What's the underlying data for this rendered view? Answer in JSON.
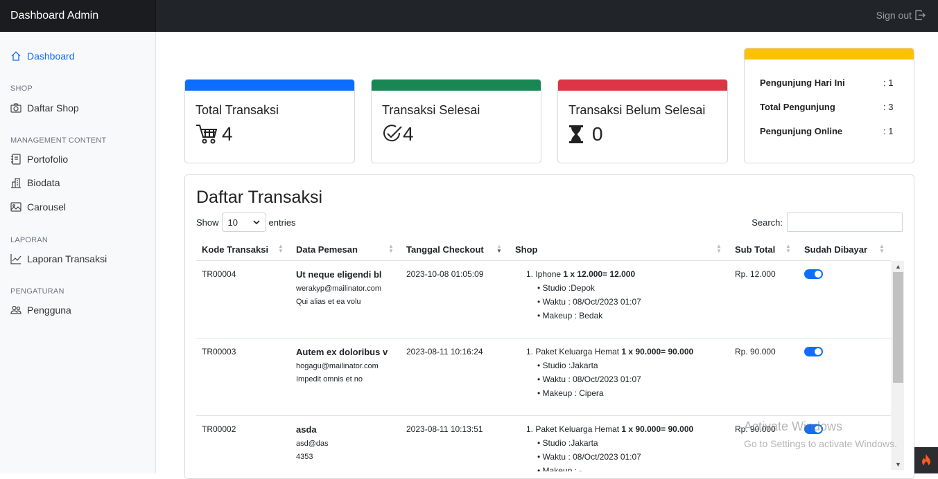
{
  "app": {
    "brand": "Dashboard Admin",
    "signout": "Sign out"
  },
  "sidebar": {
    "dashboard": "Dashboard",
    "shop_head": "SHOP",
    "daftar_shop": "Daftar Shop",
    "content_head": "MANAGEMENT CONTENT",
    "portofolio": "Portofolio",
    "biodata": "Biodata",
    "carousel": "Carousel",
    "laporan_head": "LAPORAN",
    "laporan_transaksi": "Laporan Transaksi",
    "pengaturan_head": "PENGATURAN",
    "pengguna": "Pengguna"
  },
  "cards": [
    {
      "title": "Total Transaksi",
      "value": "4",
      "color": "#0d6efd",
      "icon": "cart-icon"
    },
    {
      "title": "Transaksi Selesai",
      "value": "4",
      "color": "#198754",
      "icon": "check-circle-icon"
    },
    {
      "title": "Transaksi Belum Selesai",
      "value": "0",
      "color": "#dc3545",
      "icon": "hourglass-icon"
    }
  ],
  "stats": {
    "color": "#ffc107",
    "rows": [
      {
        "label": "Pengunjung Hari Ini",
        "value": ": 1"
      },
      {
        "label": "Total Pengunjung",
        "value": ": 3"
      },
      {
        "label": "Pengunjung Online",
        "value": ": 1"
      }
    ]
  },
  "table": {
    "title": "Daftar Transaksi",
    "show": "Show",
    "entries_value": "10",
    "entries": "entries",
    "search": "Search:",
    "headers": [
      "Kode Transaksi",
      "Data Pemesan",
      "Tanggal Checkout",
      "Shop",
      "Sub Total",
      "Sudah Dibayar"
    ],
    "rows": [
      {
        "kode": "TR00004",
        "nama": "Ut neque eligendi bl",
        "email": "werakyp@mailinator.com",
        "note": "Qui alias et ea volu",
        "tanggal": "2023-10-08 01:05:09",
        "item": "1. Iphone ",
        "qty": "1 x 12.000= 12.000",
        "studio": "Studio :Depok",
        "waktu": "Waktu : 08/Oct/2023 01:07",
        "makeup": "Makeup : Bedak",
        "subtotal": "Rp. 12.000"
      },
      {
        "kode": "TR00003",
        "nama": "Autem ex doloribus v",
        "email": "hogagu@mailinator.com",
        "note": "Impedit omnis et no",
        "tanggal": "2023-08-11 10:16:24",
        "item": "1. Paket Keluarga Hemat ",
        "qty": "1 x 90.000= 90.000",
        "studio": "Studio :Jakarta",
        "waktu": "Waktu : 08/Oct/2023 01:07",
        "makeup": "Makeup : Cipera",
        "subtotal": "Rp. 90.000"
      },
      {
        "kode": "TR00002",
        "nama": "asda",
        "email": "asd@das",
        "note": "4353",
        "tanggal": "2023-08-11 10:13:51",
        "item": "1. Paket Keluarga Hemat ",
        "qty": "1 x 90.000= 90.000",
        "studio": "Studio :Jakarta",
        "waktu": "Waktu : 08/Oct/2023 01:07",
        "makeup": "Makeup : -",
        "subtotal": "Rp. 90.000"
      }
    ]
  },
  "watermark": {
    "line1": "Activate Windows",
    "line2": "Go to Settings to activate Windows."
  }
}
